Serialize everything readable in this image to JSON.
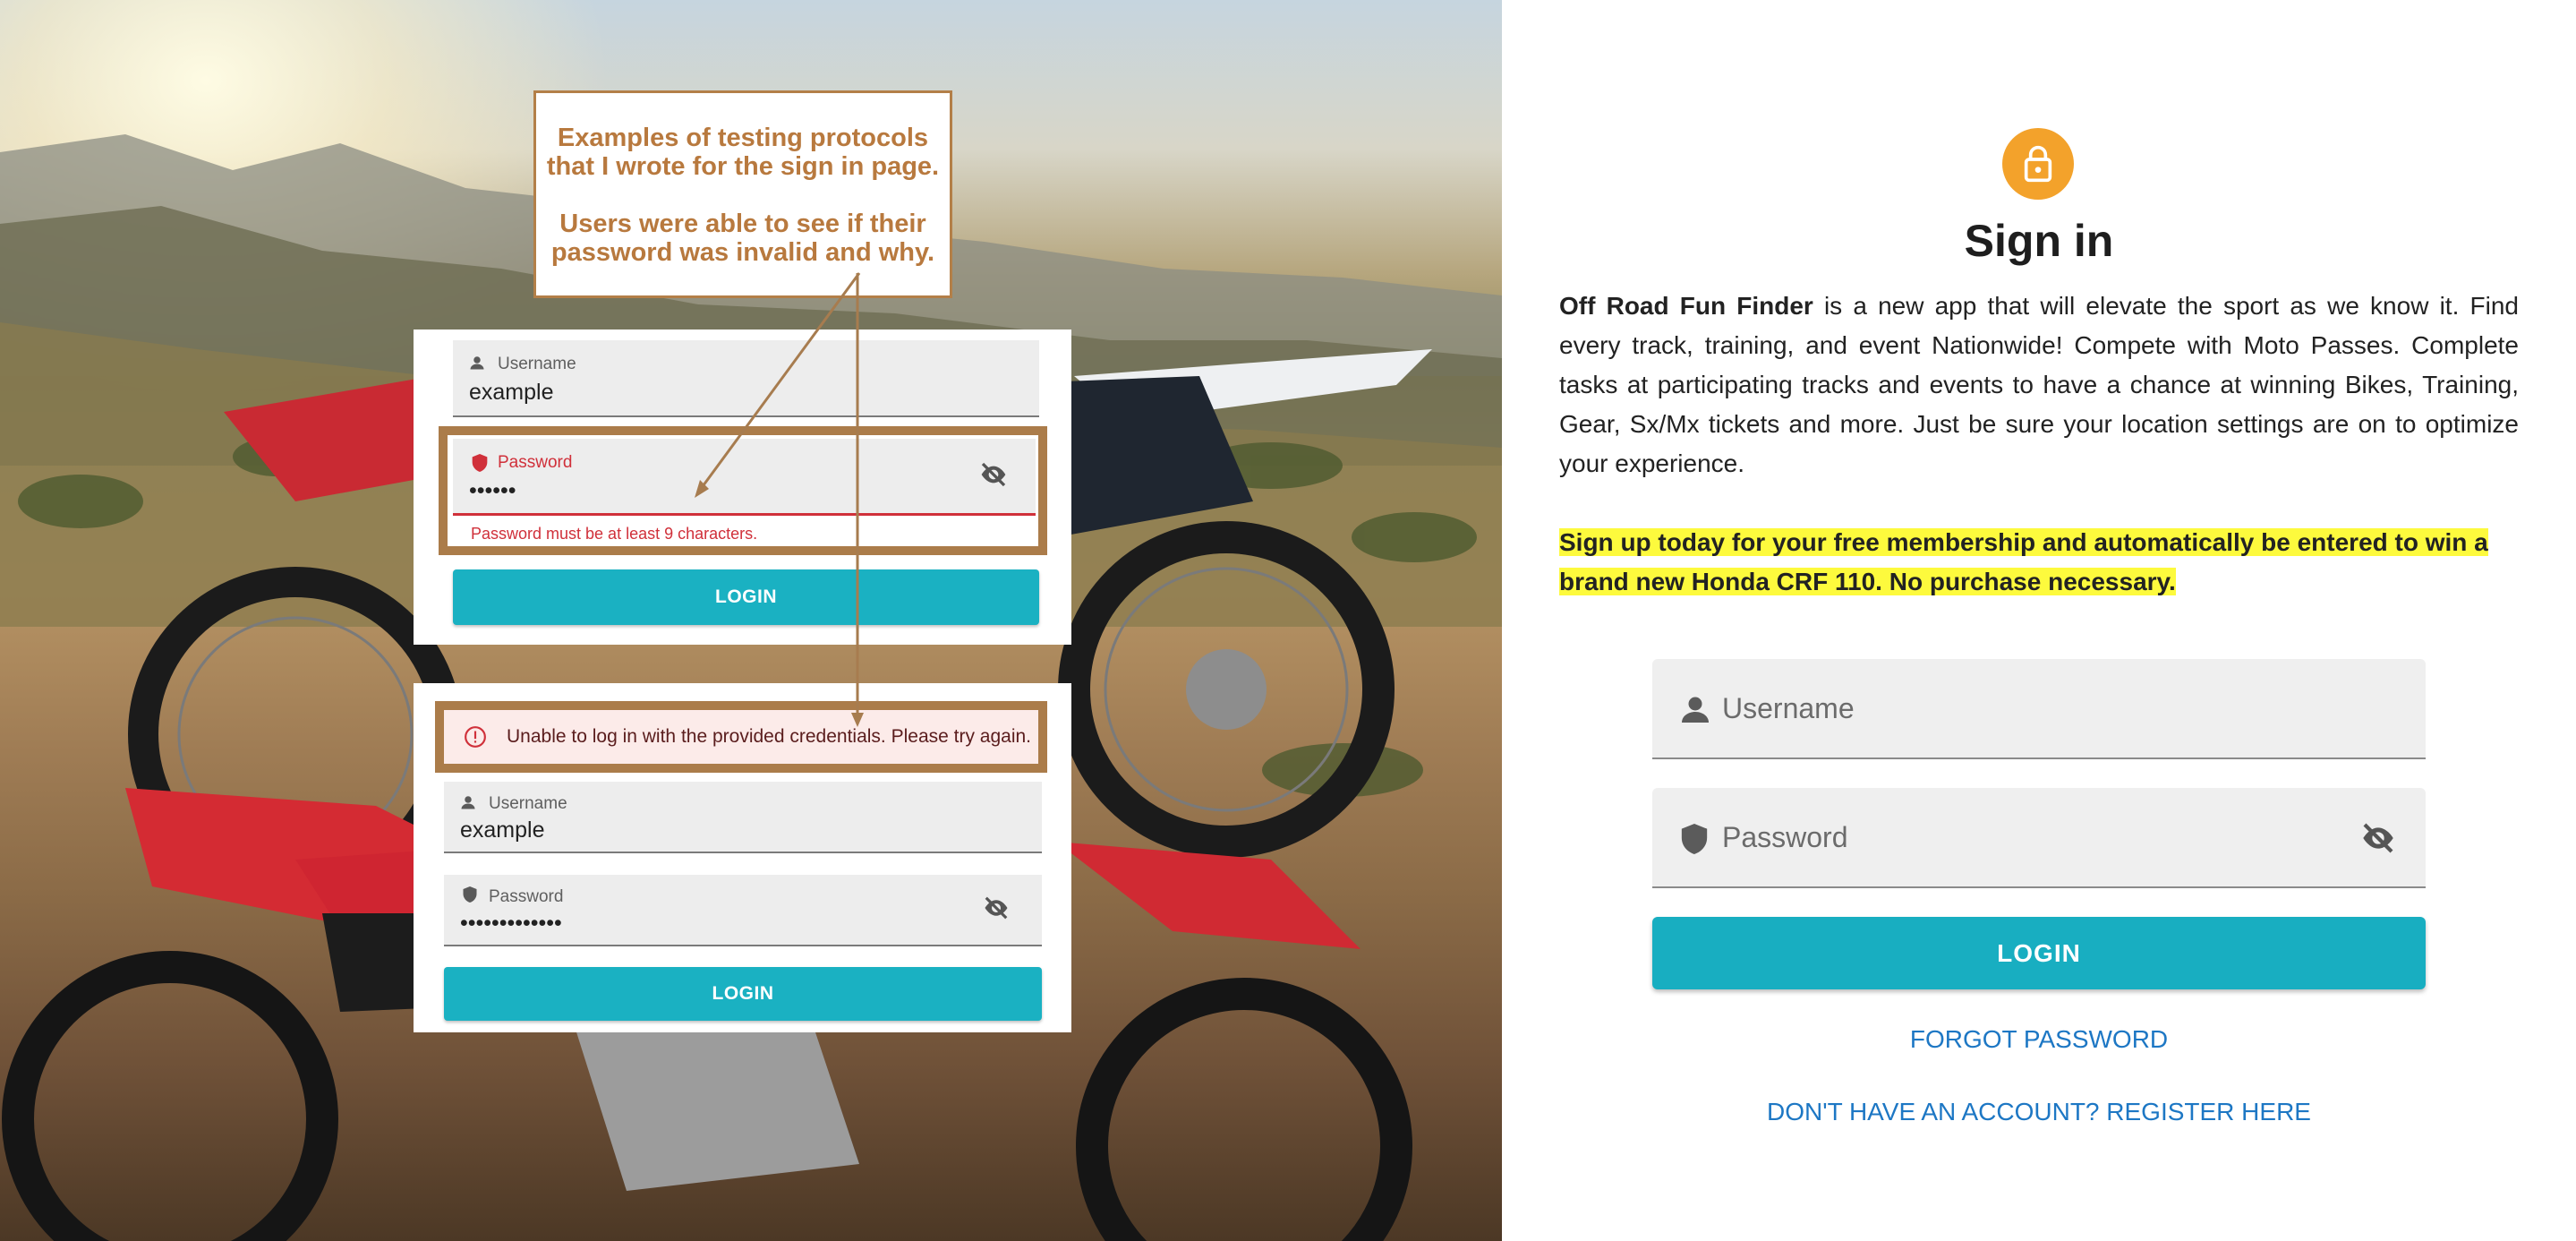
{
  "annotation": {
    "line1": "Examples of testing protocols that I wrote for the sign in page.",
    "line2": "Users were able to see if their password was invalid and why."
  },
  "example_top": {
    "username_label": "Username",
    "username_value": "example",
    "password_label": "Password",
    "password_value": "••••••",
    "error": "Password must be at least 9 characters.",
    "login_label": "LOGIN"
  },
  "example_bottom": {
    "alert": "Unable to log in with the provided credentials. Please try again.",
    "username_label": "Username",
    "username_value": "example",
    "password_label": "Password",
    "password_value": "•••••••••••••",
    "login_label": "LOGIN"
  },
  "signin": {
    "title": "Sign in",
    "app_name": "Off Road Fun Finder",
    "intro": " is a new app that will elevate the sport as we know it. Find every track, training, and event Nationwide! Compete with Moto Passes. Complete tasks at participating tracks and events to have a chance at winning Bikes, Training, Gear, Sx/Mx tickets and more. Just be sure your location settings are on to optimize your experience.",
    "promo": "Sign up today for your free membership and automatically be entered to win a brand new Honda CRF 110. No purchase necessary.",
    "username_placeholder": "Username",
    "password_placeholder": "Password",
    "login_label": "LOGIN",
    "forgot_label": "FORGOT PASSWORD",
    "register_label": "DON'T HAVE AN ACCOUNT? REGISTER HERE"
  },
  "colors": {
    "accent": "#18aec1",
    "lock_badge": "#f3a22b",
    "link": "#1d77c4",
    "error": "#d0303a",
    "highlight": "#fdfa3d",
    "annotation": "#b8793e"
  },
  "icons": [
    "lock-icon",
    "person-icon",
    "shield-icon",
    "visibility-off-icon",
    "error-circle-icon"
  ]
}
